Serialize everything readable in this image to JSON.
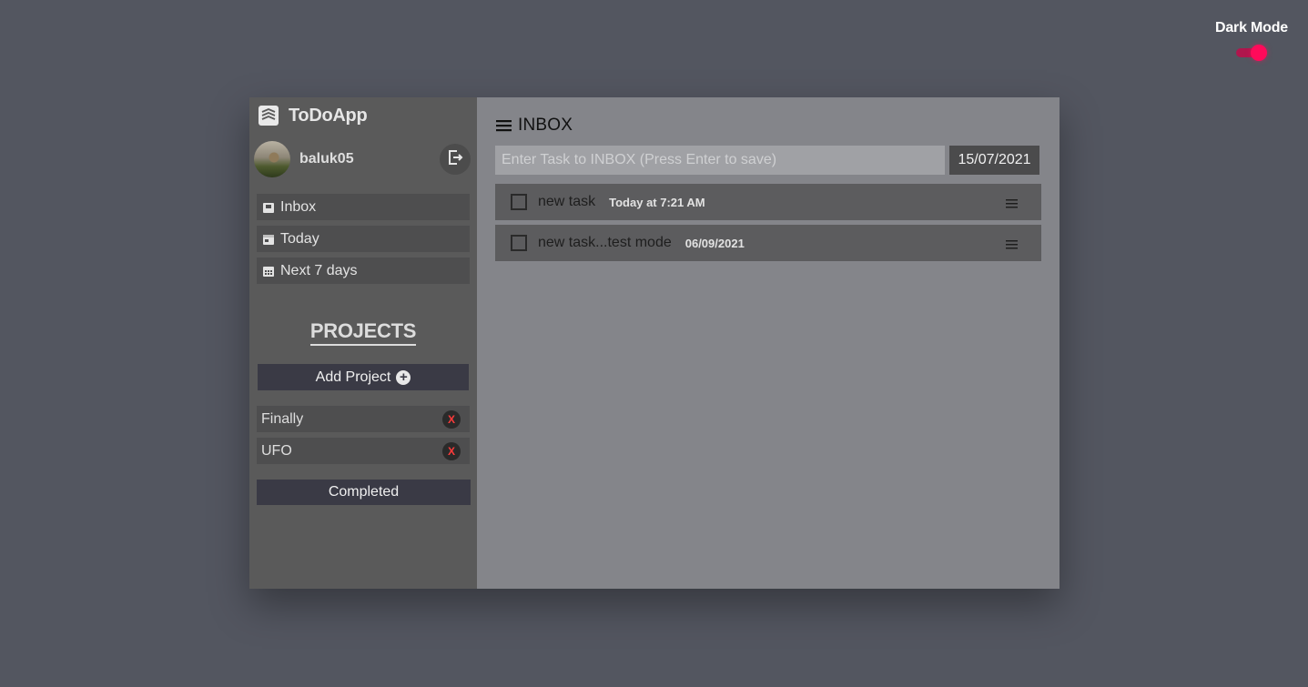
{
  "dark_mode": {
    "label": "Dark Mode",
    "enabled": true,
    "accent": "#ff0a5a"
  },
  "app": {
    "name": "ToDoApp",
    "icon": "layers-icon"
  },
  "user": {
    "name": "baluk05",
    "logout_icon": "logout-icon"
  },
  "nav": [
    {
      "label": "Inbox",
      "icon": "inbox-icon"
    },
    {
      "label": "Today",
      "icon": "calendar-today-icon"
    },
    {
      "label": "Next 7 days",
      "icon": "calendar-week-icon"
    }
  ],
  "projects": {
    "title": "PROJECTS",
    "add_label": "Add Project",
    "items": [
      {
        "label": "Finally",
        "delete_label": "X"
      },
      {
        "label": "UFO",
        "delete_label": "X"
      }
    ],
    "completed_label": "Completed"
  },
  "main": {
    "title": "INBOX",
    "input_placeholder": "Enter Task to INBOX (Press Enter to save)",
    "date": "15/07/2021",
    "tasks": [
      {
        "name": "new task",
        "date": "Today at 7:21 AM",
        "done": false
      },
      {
        "name": "new task...test mode",
        "date": "06/09/2021",
        "done": false
      }
    ]
  }
}
